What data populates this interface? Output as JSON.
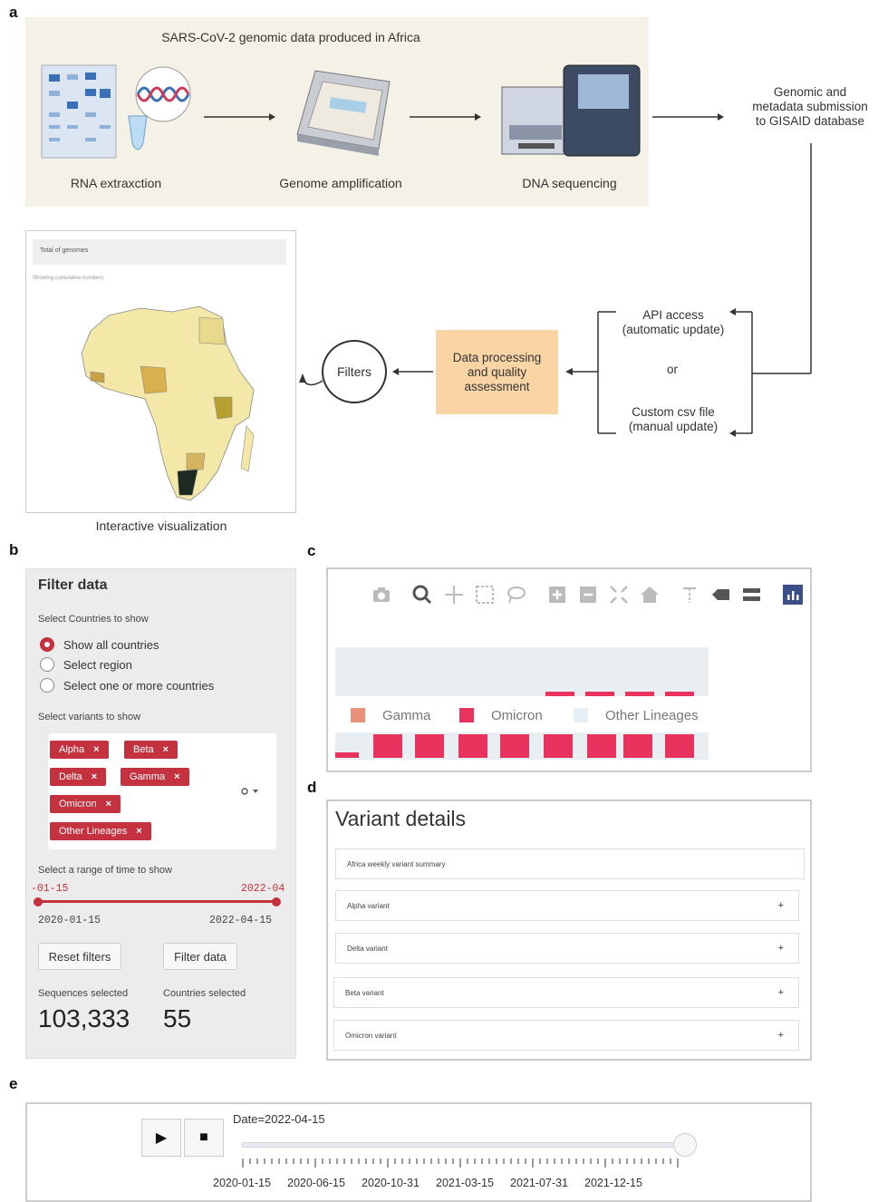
{
  "panel_letters": {
    "a": "a",
    "b": "b",
    "c": "c",
    "d": "d",
    "e": "e"
  },
  "workflow": {
    "title": "SARS-CoV-2 genomic data produced in Africa",
    "step1": "RNA extraxction",
    "step2": "Genome amplification",
    "step3": "DNA sequencing",
    "submission": [
      "Genomic and",
      "metadata submission",
      "to GISAID database"
    ],
    "api_access": [
      "API access",
      "(automatic update)"
    ],
    "or_label": "or",
    "custom_csv": [
      "Custom csv file",
      "(manual update)"
    ],
    "data_processing": [
      "Data processing",
      "and quality",
      "assessment"
    ],
    "filters": "Filters",
    "interactive": "Interactive visualization",
    "map_header": "Total of genomes",
    "map_sub": "Showing cumulative numbers"
  },
  "filter_panel": {
    "title": "Filter data",
    "countries_label": "Select Countries to show",
    "radio_options": [
      "Show all countries",
      "Select region",
      "Select one or more countries"
    ],
    "selected_radio": 0,
    "variants_label": "Select variants to show",
    "chips": [
      "Alpha",
      "Beta",
      "Delta",
      "Gamma",
      "Omicron",
      "Other Lineages"
    ],
    "chip_close": "×",
    "time_label": "Select a range of time to show",
    "range_left_cut": "-01-15",
    "range_right_cut": "2022-04",
    "range_min": "2020-01-15",
    "range_max": "2022-04-15",
    "reset_button": "Reset filters",
    "filter_button": "Filter data",
    "sequences_label": "Sequences selected",
    "sequences_value": "103,333",
    "countries_sel_label": "Countries selected",
    "countries_sel_value": "55",
    "accent_color": "#c4323f"
  },
  "chart_panel": {
    "legend": [
      "Gamma",
      "Omicron",
      "Other Lineages"
    ],
    "legend_colors": [
      "#e8927a",
      "#e8335f",
      "#e6eef6"
    ],
    "toolbar_icons": [
      "camera-icon",
      "zoom-icon",
      "pan-icon",
      "box-select-icon",
      "lasso-icon",
      "zoom-in-icon",
      "zoom-out-icon",
      "autoscale-icon",
      "home-icon",
      "spike-lines-icon",
      "hover-closest-icon",
      "hover-compare-icon",
      "plotly-logo-icon"
    ]
  },
  "variant_details": {
    "title": "Variant details",
    "rows": [
      "Africa weekly variant summary",
      "Alpha variant",
      "Delta variant",
      "Beta variant",
      "Omicron variant"
    ],
    "plus": "+"
  },
  "animation": {
    "date_label": "Date=2022-04-15",
    "play": "▶",
    "stop": "■",
    "ticks": [
      "2020-01-15",
      "2020-06-15",
      "2020-10-31",
      "2021-03-15",
      "2021-07-31",
      "2021-12-15"
    ],
    "slider_position": 1.0
  }
}
